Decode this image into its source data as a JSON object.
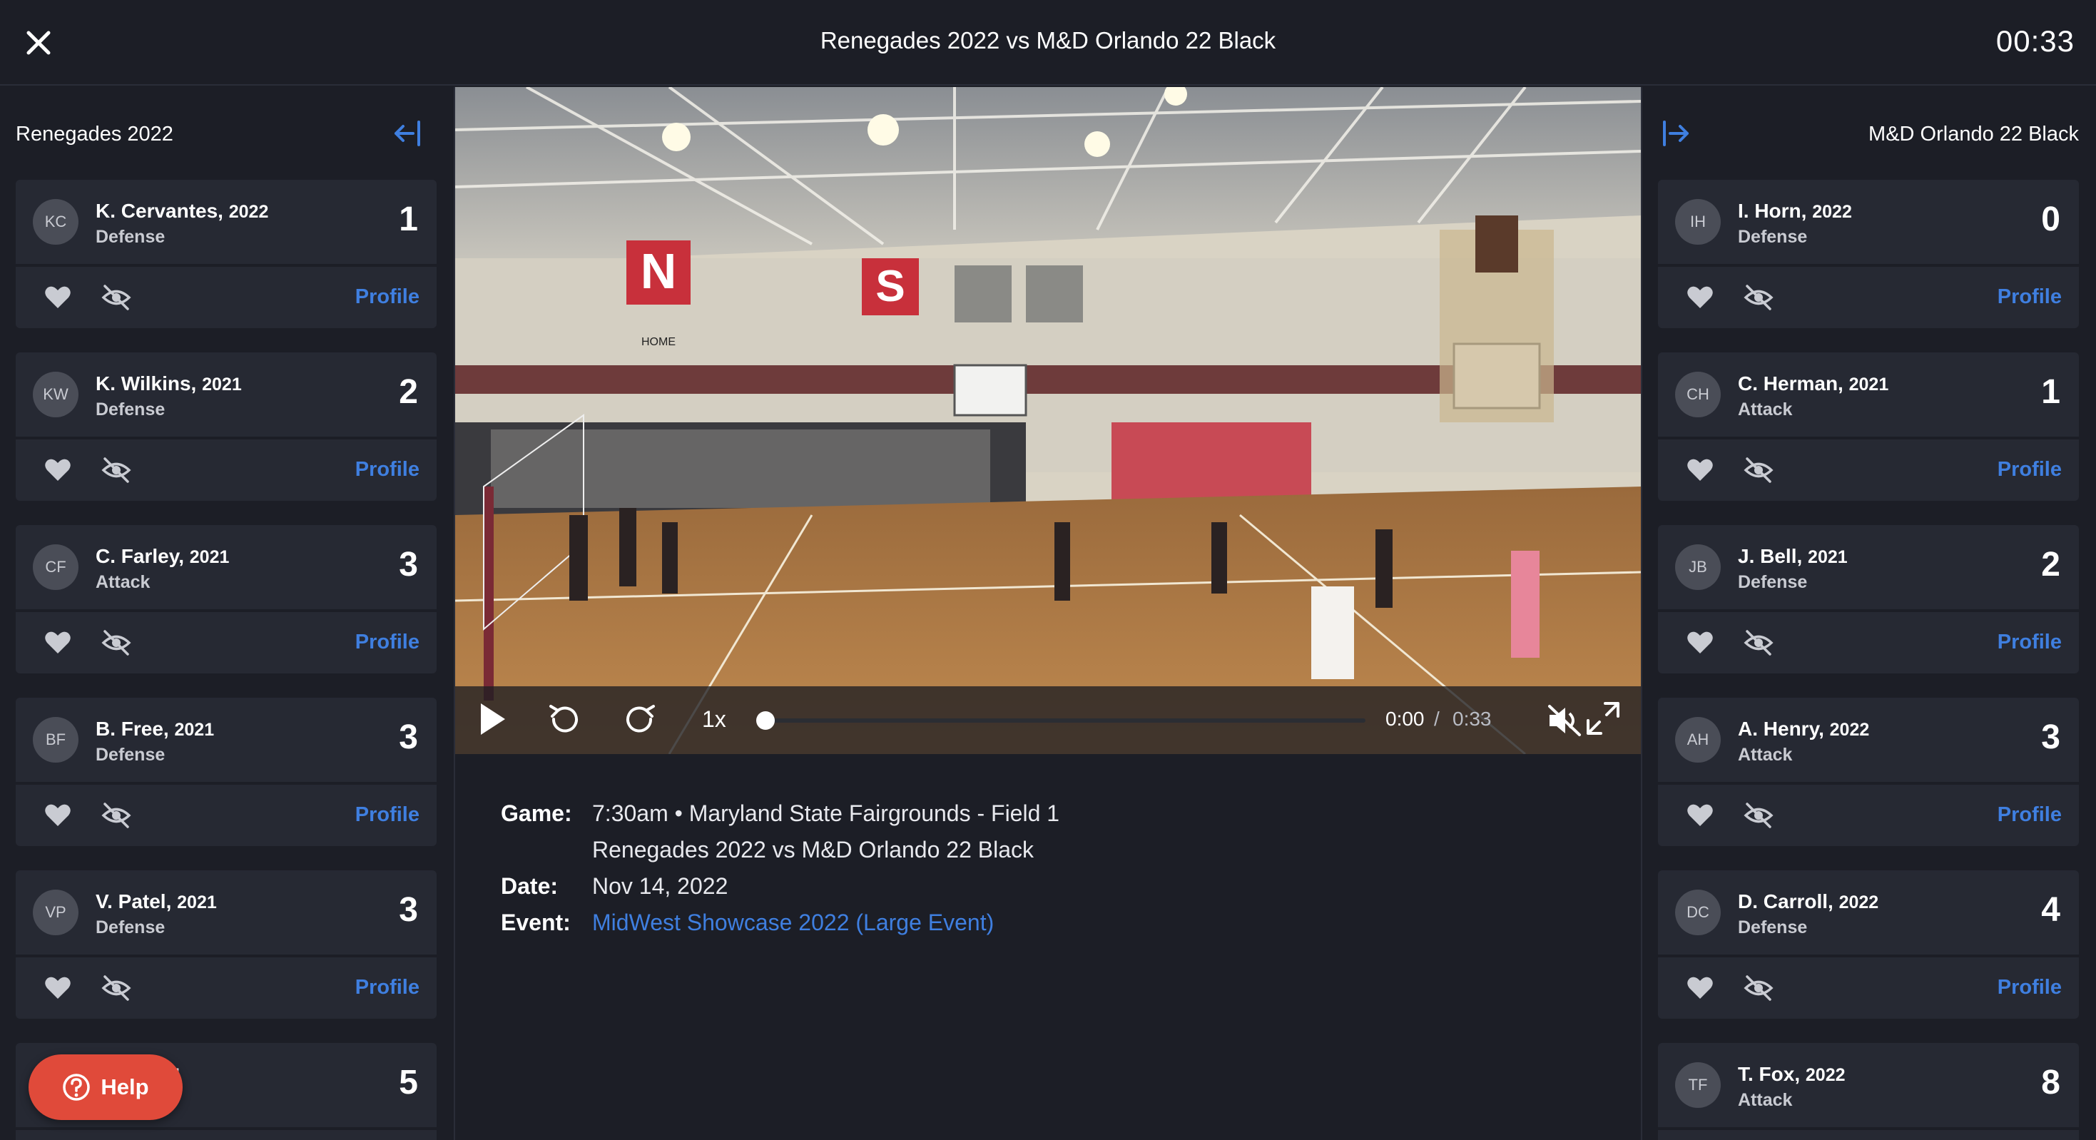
{
  "header": {
    "title": "Renegades 2022 vs M&D Orlando 22 Black",
    "timer": "00:33"
  },
  "left_panel": {
    "team": "Renegades 2022",
    "players": [
      {
        "initials": "KC",
        "name": "K. Cervantes,",
        "year": "2022",
        "position": "Defense",
        "number": "1",
        "profile": "Profile"
      },
      {
        "initials": "KW",
        "name": "K. Wilkins,",
        "year": "2021",
        "position": "Defense",
        "number": "2",
        "profile": "Profile"
      },
      {
        "initials": "CF",
        "name": "C. Farley,",
        "year": "2021",
        "position": "Attack",
        "number": "3",
        "profile": "Profile"
      },
      {
        "initials": "BF",
        "name": "B. Free,",
        "year": "2021",
        "position": "Defense",
        "number": "3",
        "profile": "Profile"
      },
      {
        "initials": "VP",
        "name": "V. Patel,",
        "year": "2021",
        "position": "Defense",
        "number": "3",
        "profile": "Profile"
      },
      {
        "initials": "",
        "name": "edo,",
        "year": "2021",
        "position": "",
        "number": "5",
        "profile": ""
      }
    ]
  },
  "right_panel": {
    "team": "M&D Orlando 22 Black",
    "players": [
      {
        "initials": "IH",
        "name": "I. Horn,",
        "year": "2022",
        "position": "Defense",
        "number": "0",
        "profile": "Profile"
      },
      {
        "initials": "CH",
        "name": "C. Herman,",
        "year": "2021",
        "position": "Attack",
        "number": "1",
        "profile": "Profile"
      },
      {
        "initials": "JB",
        "name": "J. Bell,",
        "year": "2021",
        "position": "Defense",
        "number": "2",
        "profile": "Profile"
      },
      {
        "initials": "AH",
        "name": "A. Henry,",
        "year": "2022",
        "position": "Attack",
        "number": "3",
        "profile": "Profile"
      },
      {
        "initials": "DC",
        "name": "D. Carroll,",
        "year": "2022",
        "position": "Defense",
        "number": "4",
        "profile": "Profile"
      },
      {
        "initials": "TF",
        "name": "T. Fox,",
        "year": "2022",
        "position": "Attack",
        "number": "8",
        "profile": ""
      }
    ]
  },
  "player": {
    "speed": "1x",
    "current_time": "0:00",
    "separator": "/",
    "duration": "0:33",
    "progress": 0,
    "muted": true,
    "banners": [
      "N",
      "S"
    ],
    "home_sign": "HOME"
  },
  "game_info": {
    "game_label": "Game:",
    "game_line1": "7:30am • Maryland State Fairgrounds - Field 1",
    "game_line2": "Renegades 2022 vs M&D Orlando 22 Black",
    "date_label": "Date:",
    "date": "Nov 14, 2022",
    "event_label": "Event:",
    "event": "MidWest Showcase 2022 (Large Event)"
  },
  "help": {
    "label": "Help"
  },
  "colors": {
    "background": "#1c1e26",
    "card": "#262933",
    "link": "#3f7fe0",
    "help": "#e04a3a"
  }
}
